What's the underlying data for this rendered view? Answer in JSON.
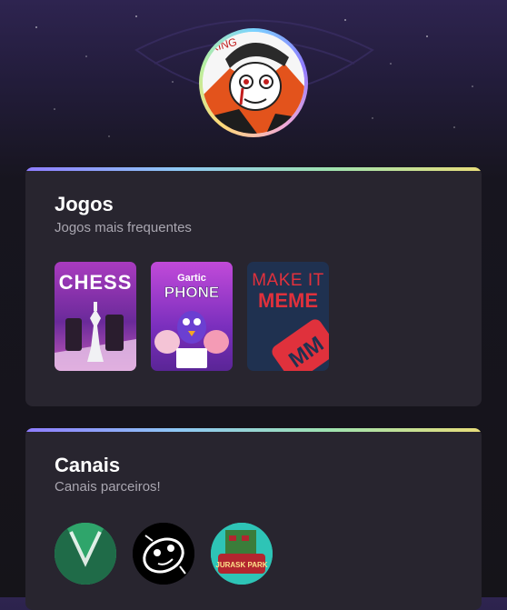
{
  "profile": {
    "avatar_icon": "profile-avatar-king-character",
    "crown_text": "KING"
  },
  "sections": {
    "games": {
      "title": "Jogos",
      "subtitle": "Jogos mais frequentes",
      "items": [
        {
          "name": "Chess",
          "cover_text": "CHESS",
          "colors": [
            "#c13fb8",
            "#5a2a8a"
          ]
        },
        {
          "name": "Gartic Phone",
          "cover_text_top": "Gartic",
          "cover_text": "PHONE",
          "colors": [
            "#b73ad6",
            "#4a1f8f"
          ]
        },
        {
          "name": "Make It Meme",
          "cover_text_top": "MAKE IT",
          "cover_text": "MEME",
          "cover_badge": "MM",
          "colors": [
            "#1f3150",
            "#e0313c"
          ]
        }
      ]
    },
    "channels": {
      "title": "Canais",
      "subtitle": "Canais parceiros!",
      "items": [
        {
          "name": "channel-green-v",
          "icon": "green-v-logo-icon",
          "colors": [
            "#2fa56b",
            "#1f6b48"
          ]
        },
        {
          "name": "channel-robot",
          "icon": "robot-face-icon",
          "colors": [
            "#000000",
            "#ffffff"
          ]
        },
        {
          "name": "channel-jurassic",
          "icon": "jurassic-park-dino-icon",
          "badge": "JURASK PARK",
          "colors": [
            "#2ec4b6",
            "#b3262f"
          ]
        }
      ]
    }
  }
}
